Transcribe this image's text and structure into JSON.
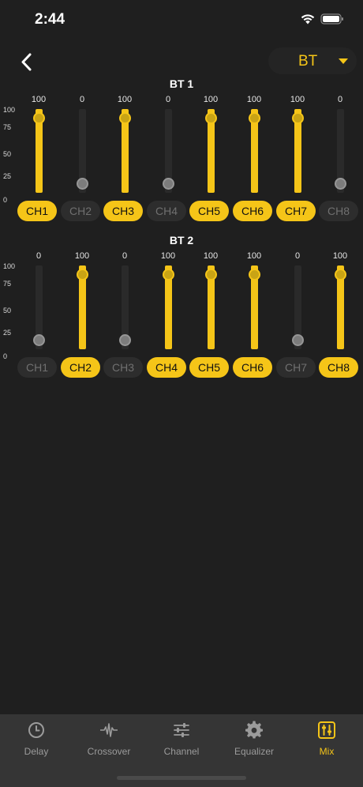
{
  "status": {
    "time": "2:44"
  },
  "header": {
    "source": "BT"
  },
  "axis_ticks": [
    "100",
    "75",
    "50",
    "25",
    "0"
  ],
  "sections": [
    {
      "title": "BT 1",
      "channels": [
        {
          "label": "CH1",
          "value": 100,
          "active": true
        },
        {
          "label": "CH2",
          "value": 0,
          "active": false
        },
        {
          "label": "CH3",
          "value": 100,
          "active": true
        },
        {
          "label": "CH4",
          "value": 0,
          "active": false
        },
        {
          "label": "CH5",
          "value": 100,
          "active": true
        },
        {
          "label": "CH6",
          "value": 100,
          "active": true
        },
        {
          "label": "CH7",
          "value": 100,
          "active": true
        },
        {
          "label": "CH8",
          "value": 0,
          "active": false
        }
      ]
    },
    {
      "title": "BT 2",
      "channels": [
        {
          "label": "CH1",
          "value": 0,
          "active": false
        },
        {
          "label": "CH2",
          "value": 100,
          "active": true
        },
        {
          "label": "CH3",
          "value": 0,
          "active": false
        },
        {
          "label": "CH4",
          "value": 100,
          "active": true
        },
        {
          "label": "CH5",
          "value": 100,
          "active": true
        },
        {
          "label": "CH6",
          "value": 100,
          "active": true
        },
        {
          "label": "CH7",
          "value": 0,
          "active": false
        },
        {
          "label": "CH8",
          "value": 100,
          "active": true
        }
      ]
    }
  ],
  "tabs": [
    {
      "label": "Delay",
      "icon": "clock-icon",
      "active": false
    },
    {
      "label": "Crossover",
      "icon": "waveform-icon",
      "active": false
    },
    {
      "label": "Channel",
      "icon": "sliders-icon",
      "active": false
    },
    {
      "label": "Equalizer",
      "icon": "gear-icon",
      "active": false
    },
    {
      "label": "Mix",
      "icon": "mixer-icon",
      "active": true
    }
  ],
  "colors": {
    "accent": "#f5c518",
    "background": "#1f1f1f",
    "tab_bar": "#353535"
  }
}
